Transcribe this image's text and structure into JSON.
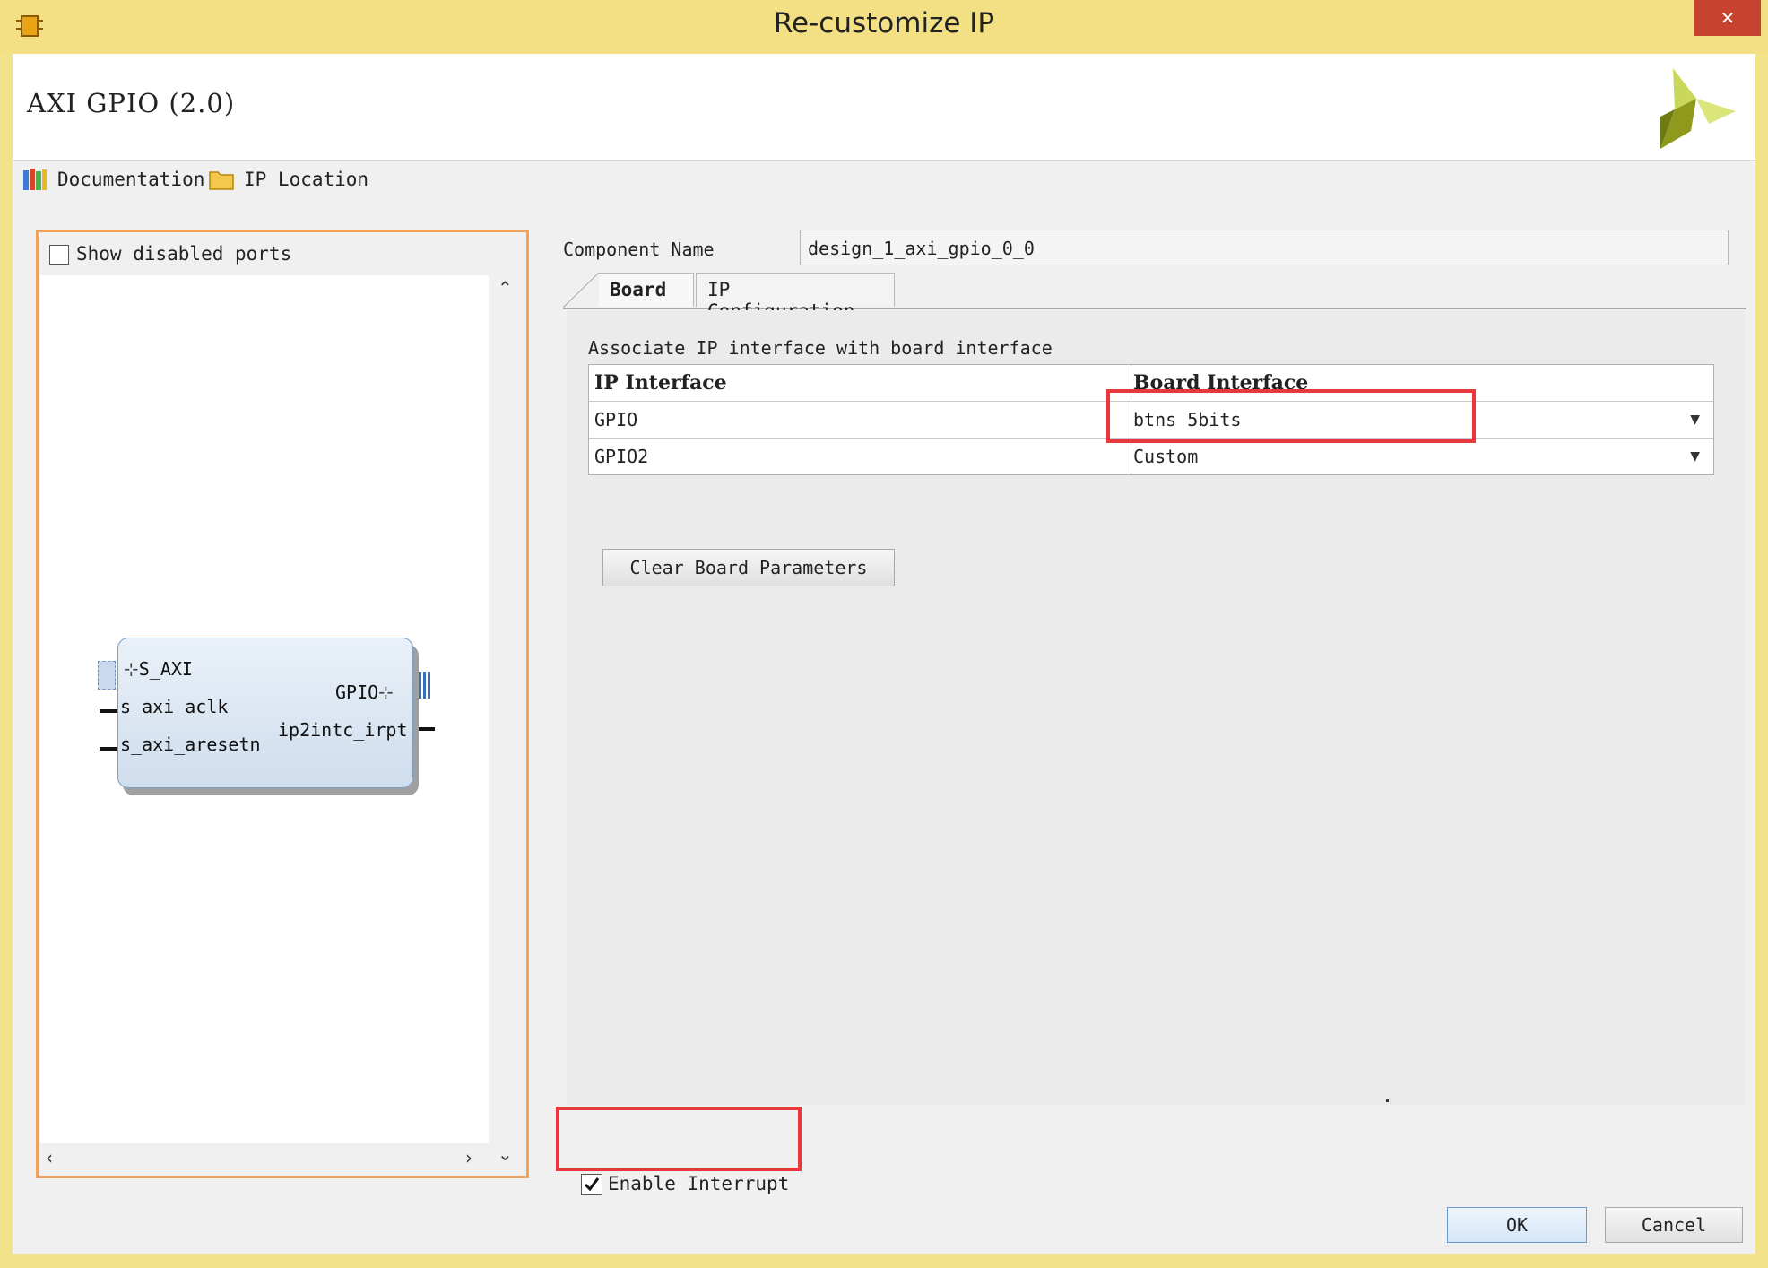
{
  "window": {
    "title": "Re-customize IP",
    "close_glyph": "✕"
  },
  "header": {
    "ip_title": "AXI GPIO (2.0)"
  },
  "toolbar": {
    "documentation": "Documentation",
    "ip_location": "IP Location"
  },
  "left_panel": {
    "show_disabled_ports": "Show disabled ports",
    "show_disabled_checked": false,
    "block": {
      "left_ports": [
        "S_AXI",
        "s_axi_aclk",
        "s_axi_aresetn"
      ],
      "right_ports": [
        "GPIO",
        "ip2intc_irpt"
      ]
    }
  },
  "component": {
    "label": "Component Name",
    "value": "design_1_axi_gpio_0_0"
  },
  "tabs": [
    {
      "label": "Board",
      "active": true
    },
    {
      "label": "IP Configuration",
      "active": false
    }
  ],
  "board_tab": {
    "associate_label": "Associate IP interface with board interface",
    "columns": [
      "IP Interface",
      "Board Interface"
    ],
    "rows": [
      {
        "ip_interface": "GPIO",
        "board_interface": "btns 5bits"
      },
      {
        "ip_interface": "GPIO2",
        "board_interface": "Custom"
      }
    ],
    "clear_button": "Clear Board Parameters"
  },
  "enable_interrupt": {
    "label": "Enable Interrupt",
    "checked": true
  },
  "buttons": {
    "ok": "OK",
    "cancel": "Cancel"
  },
  "colors": {
    "title_bar": "#f3e084",
    "highlight_box": "#e8383d",
    "panel_border": "#f0a25a",
    "block_fill": "#d6e3f0"
  }
}
